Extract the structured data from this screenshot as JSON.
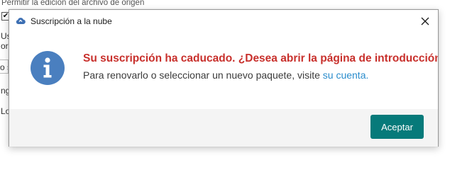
{
  "background": {
    "top_label": "Permitir la edición del archivo de origen",
    "check_mark": "✔",
    "fragments": [
      "Us",
      "or",
      "o s",
      "ng",
      "Lo"
    ]
  },
  "dialog": {
    "title": "Suscripción a la nube",
    "title_icon": "cloud-icon",
    "close_icon": "close-icon",
    "message_main": "Su suscripción ha caducado. ¿Desea abrir la página de introducción pa",
    "message_sub_prefix": "Para renovarlo o seleccionar un nuevo paquete, visite ",
    "message_link": "su cuenta.",
    "info_icon": "info-icon",
    "accept_label": "Aceptar"
  },
  "colors": {
    "error_text": "#c8302c",
    "link": "#2a8ccc",
    "accent_button": "#067a7a",
    "info_circle": "#4a7fbf"
  }
}
